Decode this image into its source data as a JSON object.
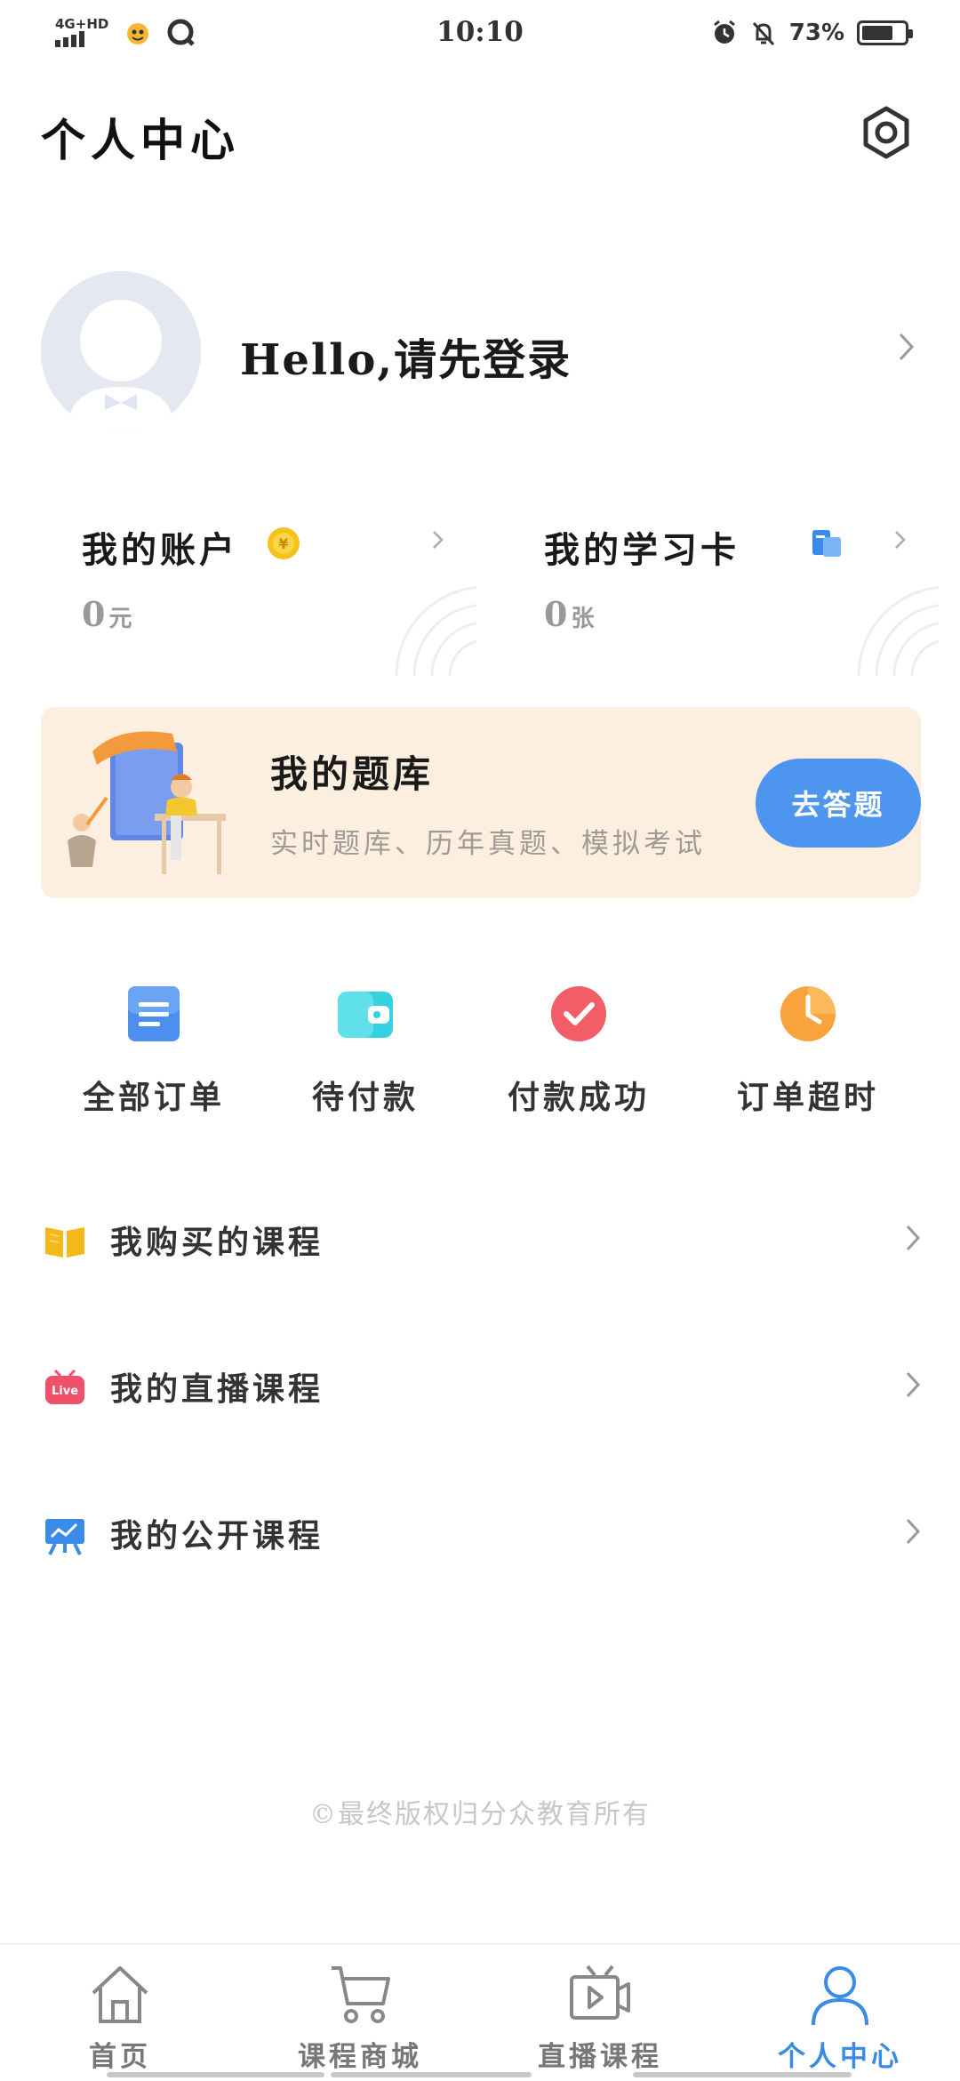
{
  "status_bar": {
    "network": "4G+HD",
    "time": "10:10",
    "battery": "73%",
    "battery_level": 0.73
  },
  "header": {
    "title": "个人中心",
    "settings_icon": "settings-hexagon-icon"
  },
  "profile": {
    "login_prompt": "Hello,请先登录"
  },
  "cards": {
    "account": {
      "title": "我的账户",
      "value": "0",
      "unit": "元",
      "icon": "coin-icon",
      "color": "#f5c21b"
    },
    "study_card": {
      "title": "我的学习卡",
      "value": "0",
      "unit": "张",
      "icon": "study-card-icon",
      "color": "#3a8be8"
    }
  },
  "banner": {
    "title": "我的题库",
    "subtitle": "实时题库、历年真题、模拟考试",
    "button": "去答题",
    "color": "#4d95ee"
  },
  "orders": [
    {
      "label": "全部订单",
      "icon": "document-icon",
      "color": "#4d8fee"
    },
    {
      "label": "待付款",
      "icon": "wallet-icon",
      "color": "#34d1e0"
    },
    {
      "label": "付款成功",
      "icon": "check-circle-icon",
      "color": "#f0505a"
    },
    {
      "label": "订单超时",
      "icon": "clock-icon",
      "color": "#f8a33c"
    }
  ],
  "menu": [
    {
      "label": "我购买的课程",
      "icon": "book-icon",
      "color": "#f5b81b"
    },
    {
      "label": "我的直播课程",
      "icon": "live-icon",
      "icon_text": "Live",
      "color": "#f0506a"
    },
    {
      "label": "我的公开课程",
      "icon": "open-course-icon",
      "color": "#3a8be8"
    }
  ],
  "copyright": "©最终版权归分众教育所有",
  "tabbar": [
    {
      "label": "首页",
      "icon": "home-icon"
    },
    {
      "label": "课程商城",
      "icon": "cart-icon"
    },
    {
      "label": "直播课程",
      "icon": "video-icon"
    },
    {
      "label": "个人中心",
      "icon": "user-icon",
      "active": true
    }
  ],
  "colors": {
    "accent": "#3a8be8",
    "banner_bg": "#fcefe0"
  }
}
